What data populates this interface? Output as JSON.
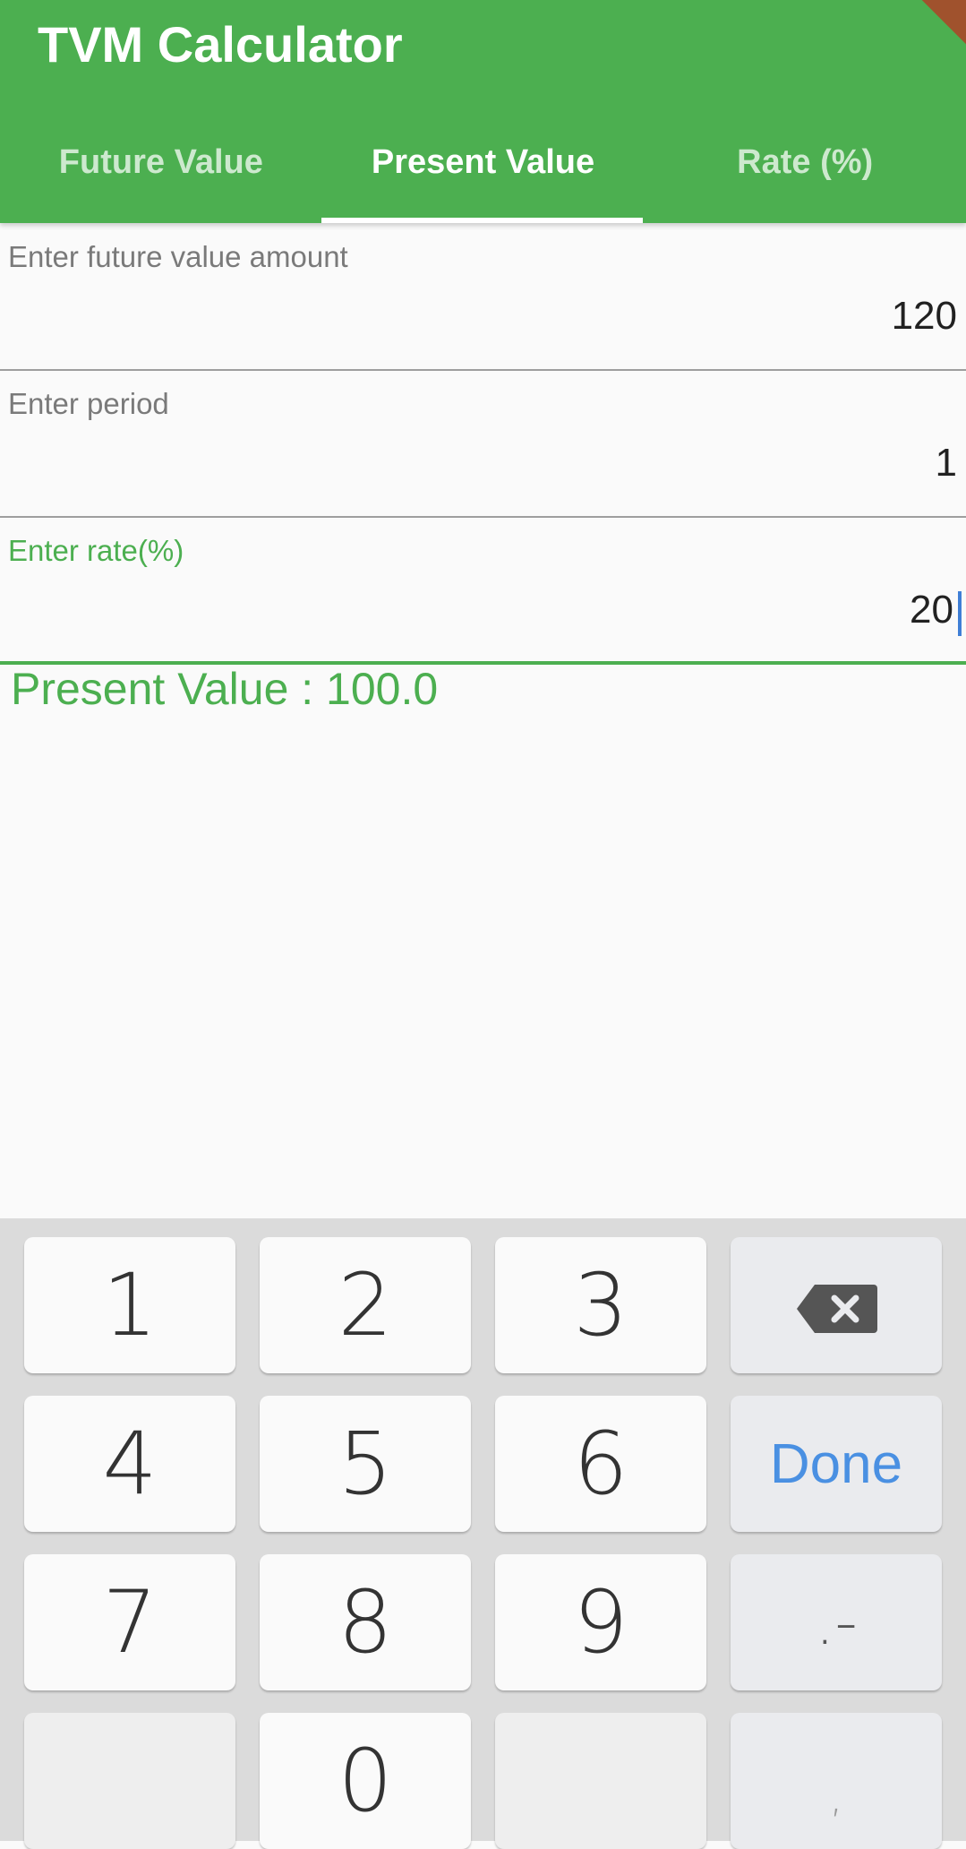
{
  "app": {
    "title": "TVM Calculator",
    "accent_color": "#4caf50"
  },
  "tabs": [
    {
      "label": "Future Value",
      "active": false
    },
    {
      "label": "Present Value",
      "active": true
    },
    {
      "label": "Rate (%)",
      "active": false
    }
  ],
  "form": {
    "future_value": {
      "label": "Enter future value amount",
      "value": "120"
    },
    "period": {
      "label": "Enter period",
      "value": "1"
    },
    "rate": {
      "label": "Enter rate(%)",
      "value": "20"
    }
  },
  "result": {
    "text": "Present Value : 100.0"
  },
  "keyboard": {
    "keys": {
      "k1": "1",
      "k2": "2",
      "k3": "3",
      "k4": "4",
      "k5": "5",
      "k6": "6",
      "k7": "7",
      "k8": "8",
      "k9": "9",
      "k0": "0",
      "done": "Done",
      "dot_minus": ".-",
      "comma": ","
    },
    "backspace_icon": "backspace-icon"
  }
}
